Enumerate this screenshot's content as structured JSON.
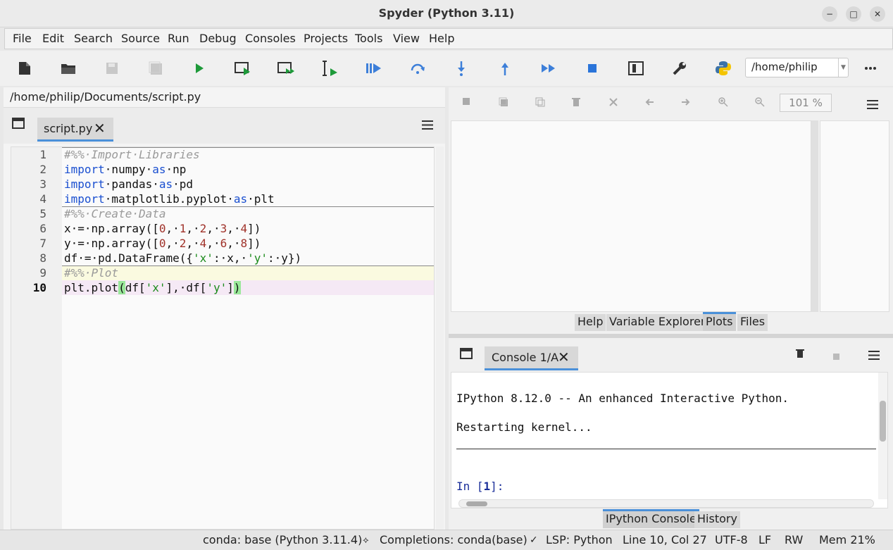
{
  "window": {
    "title": "Spyder (Python 3.11)",
    "minimize": "−",
    "maximize": "□",
    "close": "✕"
  },
  "menu": [
    "File",
    "Edit",
    "Search",
    "Source",
    "Run",
    "Debug",
    "Consoles",
    "Projects",
    "Tools",
    "View",
    "Help"
  ],
  "toolbar": {
    "icons": [
      "new-file-icon",
      "open-file-icon",
      "save-icon",
      "save-all-icon",
      "run-icon",
      "run-cell-icon",
      "run-cell-advance-icon",
      "run-selection-icon",
      "debug-icon",
      "step-over-icon",
      "step-into-icon",
      "step-out-icon",
      "continue-icon",
      "stop-icon",
      "maximize-pane-icon",
      "preferences-icon",
      "python-path-icon",
      "more-icon"
    ],
    "working_dir": "/home/philip"
  },
  "editor": {
    "path": "/home/philip/Documents/script.py",
    "tab": "script.py",
    "current_line": 10,
    "line_numbers": [
      "1",
      "2",
      "3",
      "4",
      "5",
      "6",
      "7",
      "8",
      "9",
      "10"
    ]
  },
  "plots": {
    "zoom": "101 %",
    "tabs": [
      "Help",
      "Variable Explorer",
      "Plots",
      "Files"
    ],
    "active_tab": "Plots"
  },
  "console": {
    "tab": "Console 1/A",
    "lines": [
      "IPython 8.12.0 -- An enhanced Interactive Python.",
      "Restarting kernel..."
    ],
    "prompt_prefix": "In [",
    "prompt_num": "1",
    "prompt_suffix": "]:",
    "tabs": [
      "IPython Console",
      "History"
    ],
    "active_tab": "IPython Console"
  },
  "status": {
    "env": "conda: base (Python 3.11.4)",
    "completions": "Completions: conda(base)",
    "lsp": "LSP: Python",
    "position": "Line 10, Col 27",
    "encoding": "UTF-8",
    "eol": "LF",
    "perm": "RW",
    "mem": "Mem 21%"
  },
  "colors": {
    "accent": "#4a90d9",
    "keyword": "#1a4fd0",
    "string": "#1b8a1b",
    "number": "#a0322a",
    "comment": "#9a9a9a"
  }
}
